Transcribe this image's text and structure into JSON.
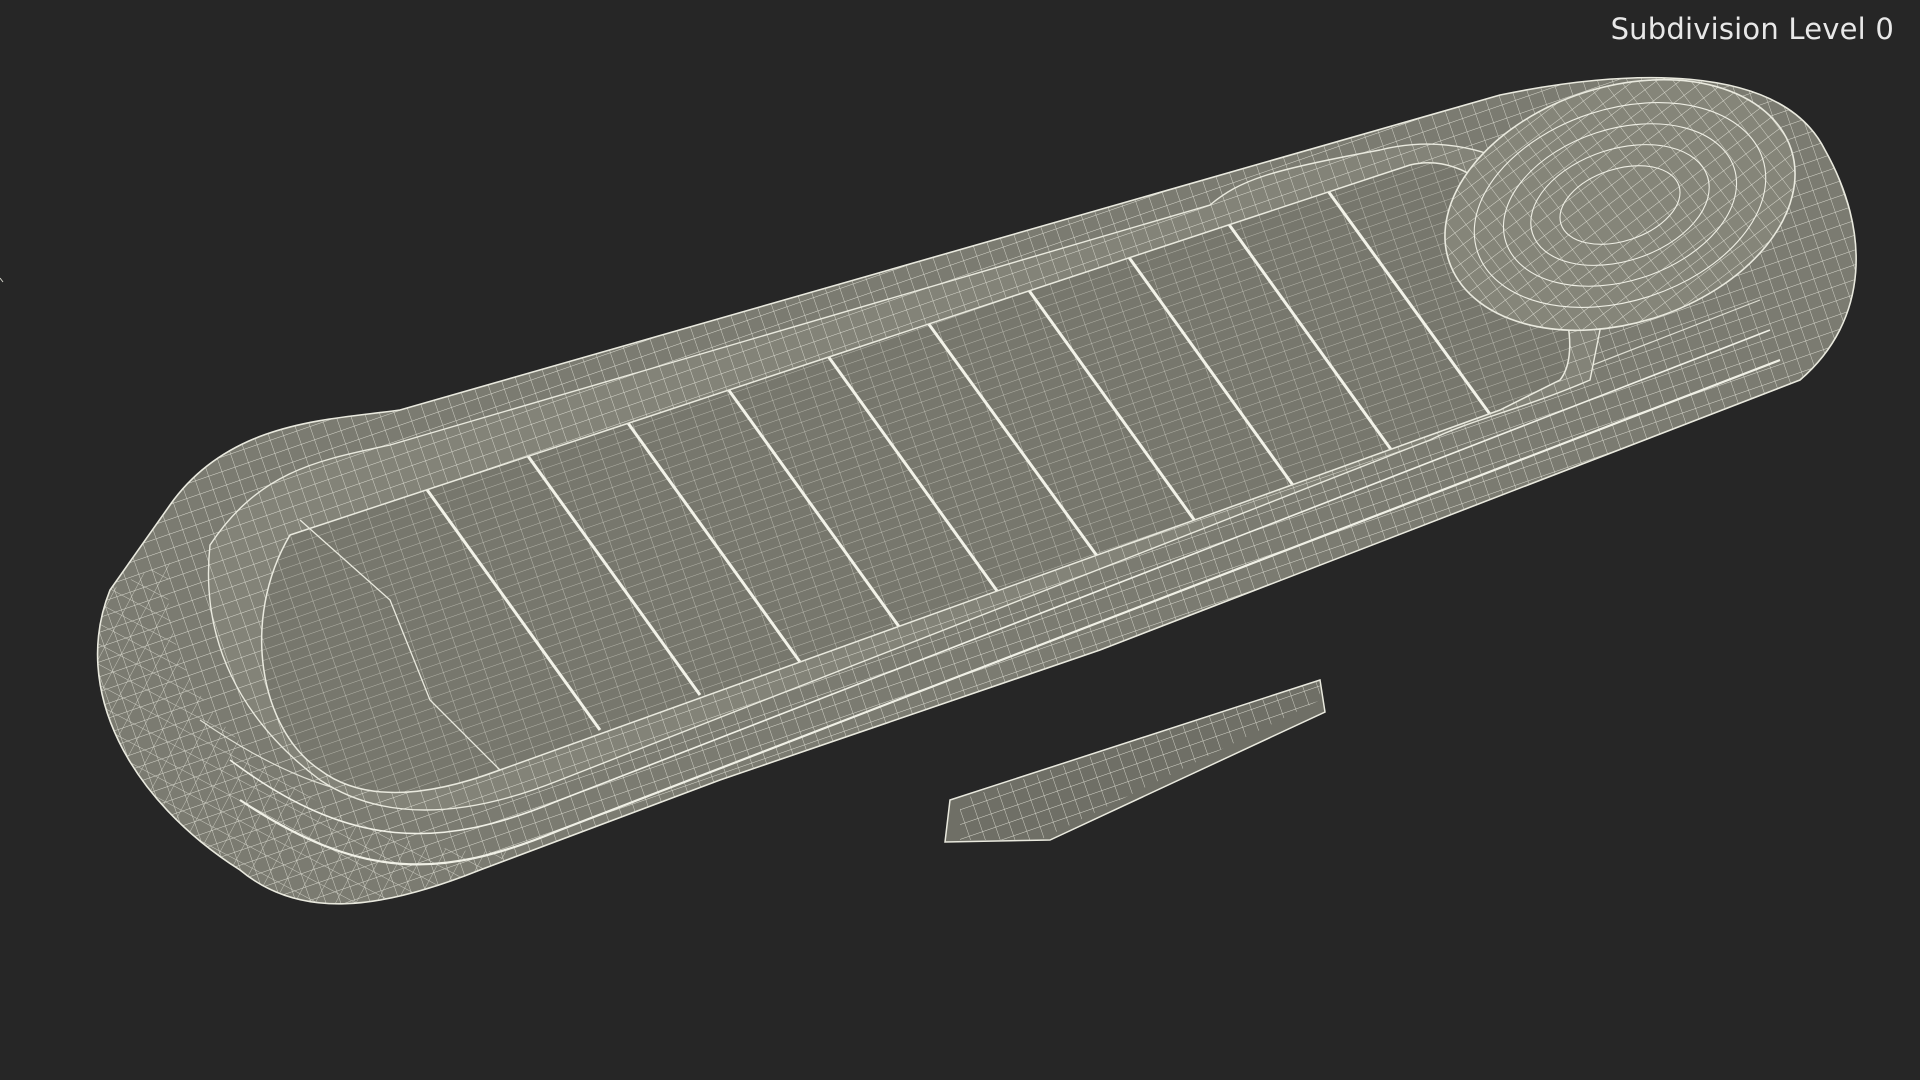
{
  "viewport": {
    "overlay_label": "Subdivision Level 0",
    "background_color": "#262626",
    "mesh_fill_color": "#7d7d73",
    "wire_color": "#e9e9de"
  },
  "model": {
    "icon": "wireframe-mesh-render"
  }
}
